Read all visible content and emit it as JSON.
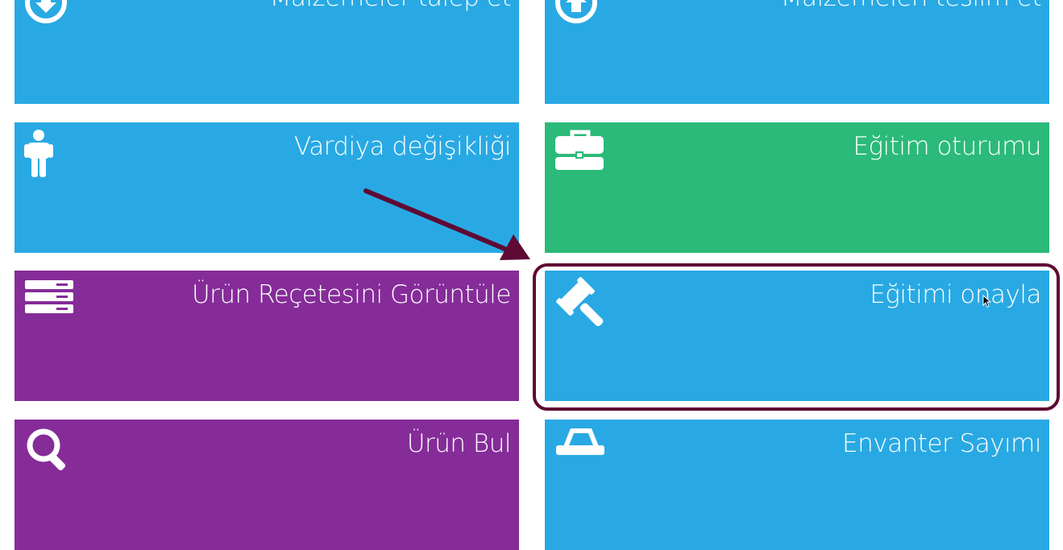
{
  "colors": {
    "blue": "#29a9e3",
    "green": "#2bba79",
    "purple": "#852c99",
    "annotation": "#5e0a34"
  },
  "tiles": [
    {
      "label": "Malzemeler talep et",
      "color": "#29a9e3",
      "icon": "download-circle-icon"
    },
    {
      "label": "Malzemeleri teslim et",
      "color": "#29a9e3",
      "icon": "upload-circle-icon"
    },
    {
      "label": "Vardiya değişikliği",
      "color": "#29a9e3",
      "icon": "person-icon"
    },
    {
      "label": "Eğitim oturumu",
      "color": "#2bba79",
      "icon": "briefcase-icon"
    },
    {
      "label": "Ürün Reçetesini Görüntüle",
      "color": "#852c99",
      "icon": "list-icon"
    },
    {
      "label": "Eğitimi onayla",
      "color": "#29a9e3",
      "icon": "gavel-icon"
    },
    {
      "label": "Ürün Bul",
      "color": "#852c99",
      "icon": "search-icon"
    },
    {
      "label": "Envanter Sayımı",
      "color": "#29a9e3",
      "icon": "cart-icon"
    }
  ]
}
